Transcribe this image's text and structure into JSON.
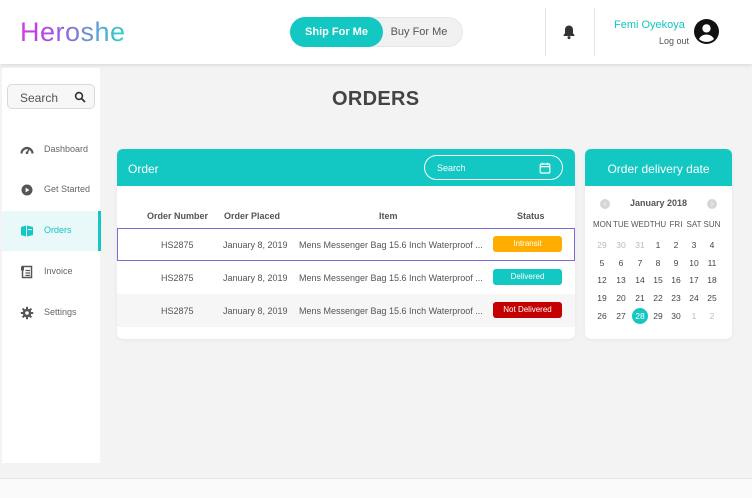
{
  "header": {
    "logo": "Heroshe",
    "toggle": {
      "active": "Ship For Me",
      "inactive": "Buy For Me"
    },
    "user_name": "Femi Oyekoya",
    "logout": "Log out",
    "icons": [
      "bell-icon",
      "avatar-icon"
    ]
  },
  "sidebar": {
    "search_label": "Search",
    "items": [
      {
        "label": "Dashboard",
        "icon": "gauge-icon",
        "active": false
      },
      {
        "label": "Get Started",
        "icon": "play-icon",
        "active": false
      },
      {
        "label": "Orders",
        "icon": "orders-icon",
        "active": true
      },
      {
        "label": "Invoice",
        "icon": "invoice-icon",
        "active": false
      },
      {
        "label": "Settings",
        "icon": "gear-icon",
        "active": false
      }
    ]
  },
  "page_title": "ORDERS",
  "orders": {
    "title": "Order",
    "search_placeholder": "Search",
    "columns": [
      "Order Number",
      "Order Placed",
      "Item",
      "Status"
    ],
    "rows": [
      {
        "number": "HS2875",
        "placed": "January 8, 2019",
        "item": "Mens Messenger Bag 15.6 Inch Waterproof ...",
        "status": "Intransit",
        "status_color": "#ffae00"
      },
      {
        "number": "HS2875",
        "placed": "January 8, 2019",
        "item": "Mens Messenger Bag 15.6 Inch Waterproof ...",
        "status": "Delivered",
        "status_color": "#13c7c2"
      },
      {
        "number": "HS2875",
        "placed": "January 8, 2019",
        "item": "Mens Messenger Bag 15.6 Inch Waterproof ...",
        "status": "Not Delivered",
        "status_color": "#c40000"
      }
    ]
  },
  "calendar": {
    "title": "Order delivery date",
    "month": "January 2018",
    "prev": "‹",
    "next": "›",
    "weekdays": [
      "MON",
      "TUE",
      "WED",
      "THU",
      "FRI",
      "SAT",
      "SUN"
    ],
    "weeks": [
      [
        "29",
        "30",
        "31",
        "1",
        "2",
        "3",
        "4"
      ],
      [
        "5",
        "6",
        "7",
        "8",
        "9",
        "10",
        "11"
      ],
      [
        "12",
        "13",
        "14",
        "15",
        "16",
        "17",
        "18"
      ],
      [
        "19",
        "20",
        "21",
        "22",
        "23",
        "24",
        "25"
      ],
      [
        "26",
        "27",
        "28",
        "29",
        "30",
        "1",
        "2"
      ]
    ],
    "selected_day": "28"
  },
  "colors": {
    "accent": "#13c7c2",
    "intransit": "#ffae00",
    "delivered": "#13c7c2",
    "not_delivered": "#c40000"
  }
}
